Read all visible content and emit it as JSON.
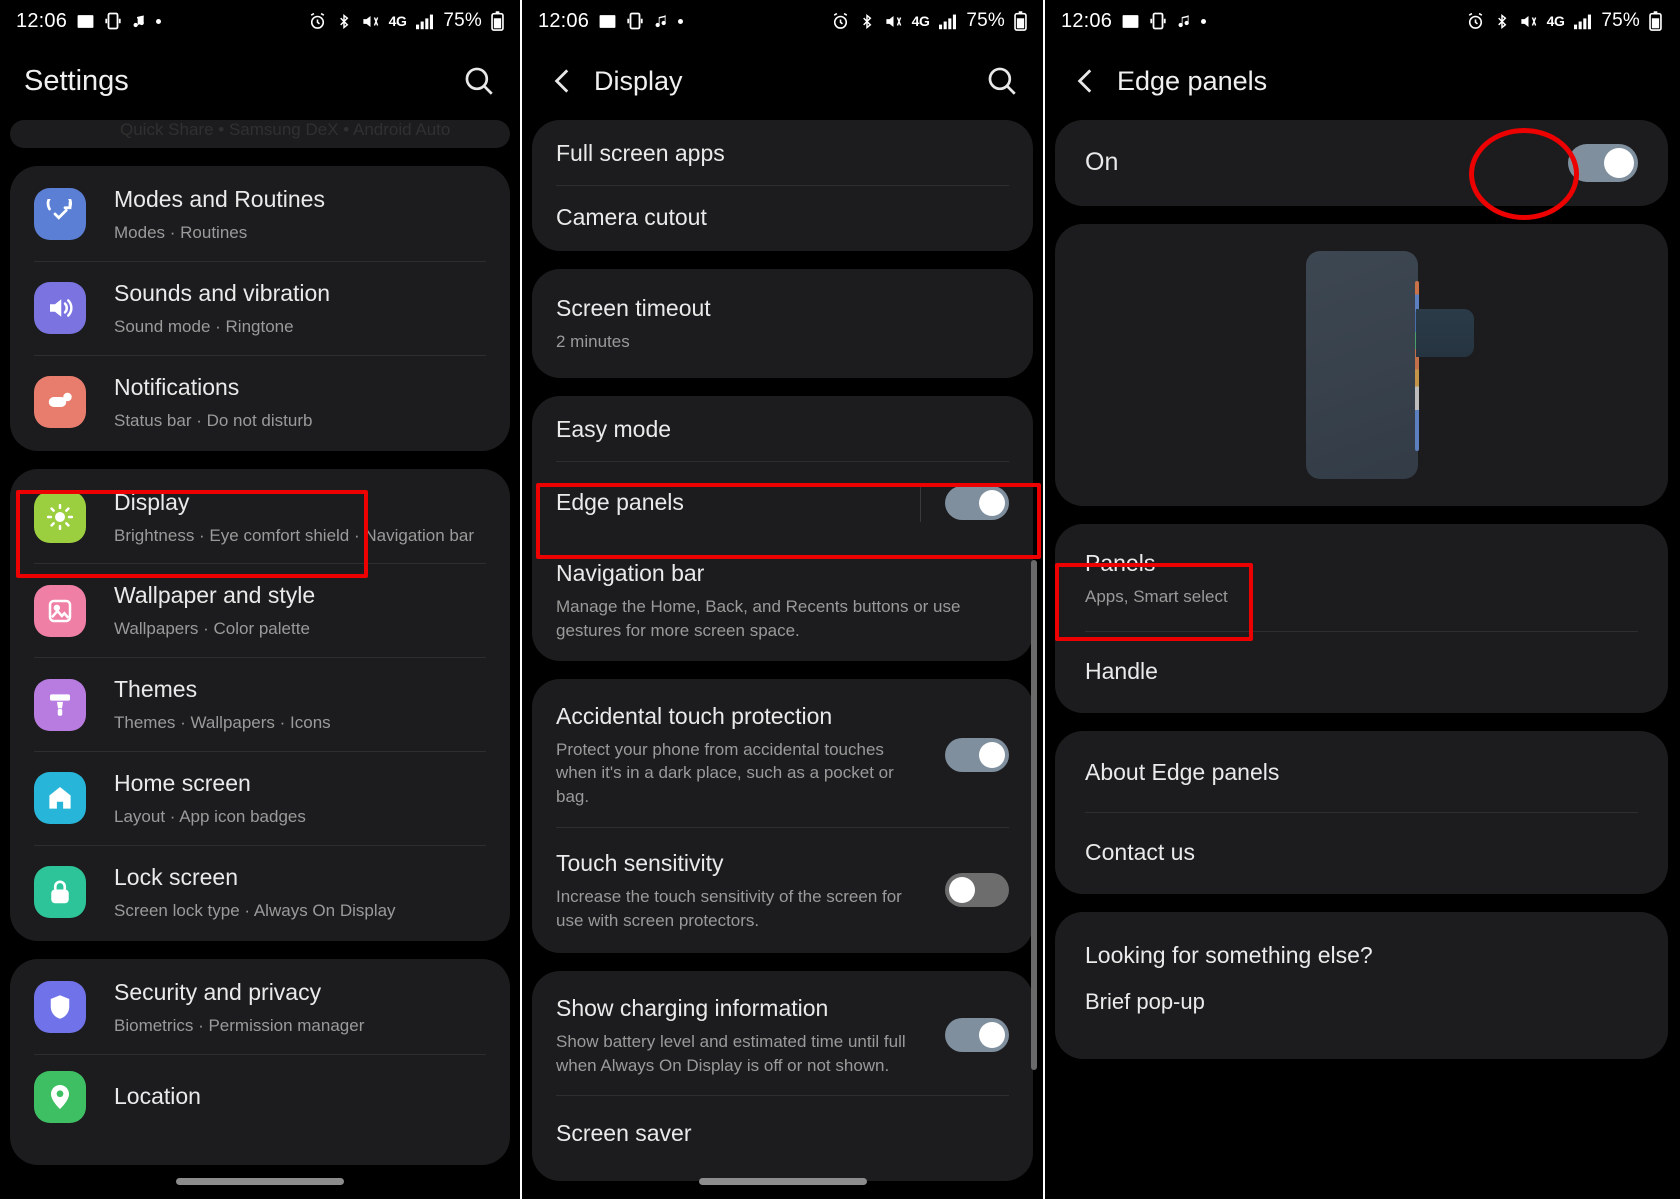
{
  "status_bar": {
    "time": "12:06",
    "left_icons": [
      "photo-icon",
      "screen-record-icon",
      "music-note-icon",
      "dot-icon"
    ],
    "right_icons": [
      "alarm-icon",
      "bluetooth-icon",
      "mute-icon",
      "network-4g-icon",
      "signal-bars-icon"
    ],
    "network_label": "4G",
    "battery_percent": "75%"
  },
  "screen1": {
    "title": "Settings",
    "search_icon": "search-icon",
    "ghost_text": "Quick Share  •  Samsung DeX  •  Android Auto",
    "groups": [
      {
        "items": [
          {
            "label": "Modes and Routines",
            "sub": "Modes  ·  Routines",
            "icon": "modes-routines-icon",
            "color": "#5b7fd4"
          },
          {
            "label": "Sounds and vibration",
            "sub": "Sound mode  ·  Ringtone",
            "icon": "sound-icon",
            "color": "#7b74e0"
          },
          {
            "label": "Notifications",
            "sub": "Status bar  ·  Do not disturb",
            "icon": "notifications-icon",
            "color": "#e87d6e"
          }
        ]
      },
      {
        "items": [
          {
            "label": "Display",
            "sub": "Brightness  ·  Eye comfort shield  ·  Navigation bar",
            "icon": "display-icon",
            "color": "#9ccf3f",
            "highlighted": true
          },
          {
            "label": "Wallpaper and style",
            "sub": "Wallpapers  ·  Color palette",
            "icon": "wallpaper-icon",
            "color": "#ef7fa4"
          },
          {
            "label": "Themes",
            "sub": "Themes  ·  Wallpapers  ·  Icons",
            "icon": "themes-icon",
            "color": "#b87ce0"
          },
          {
            "label": "Home screen",
            "sub": "Layout  ·  App icon badges",
            "icon": "home-screen-icon",
            "color": "#27b5d9"
          },
          {
            "label": "Lock screen",
            "sub": "Screen lock type  ·  Always On Display",
            "icon": "lock-screen-icon",
            "color": "#2ec49a"
          }
        ]
      },
      {
        "items": [
          {
            "label": "Security and privacy",
            "sub": "Biometrics  ·  Permission manager",
            "icon": "security-icon",
            "color": "#6f72e8"
          },
          {
            "label": "Location",
            "sub": "",
            "icon": "location-icon",
            "color": "#3fbf63"
          }
        ]
      }
    ]
  },
  "screen2": {
    "title": "Display",
    "back_icon": "chevron-left-icon",
    "search_icon": "search-icon",
    "groups": [
      {
        "items": [
          {
            "label": "Full screen apps",
            "sub": ""
          },
          {
            "label": "Camera cutout",
            "sub": ""
          }
        ]
      },
      {
        "items": [
          {
            "label": "Screen timeout",
            "sub": "2 minutes"
          }
        ]
      },
      {
        "items": [
          {
            "label": "Easy mode",
            "sub": ""
          },
          {
            "label": "Edge panels",
            "sub": "",
            "toggle": "on",
            "highlighted": true
          },
          {
            "label": "Navigation bar",
            "sub": "Manage the Home, Back, and Recents buttons or use gestures for more screen space."
          }
        ]
      },
      {
        "items": [
          {
            "label": "Accidental touch protection",
            "sub": "Protect your phone from accidental touches when it's in a dark place, such as a pocket or bag.",
            "toggle": "on"
          },
          {
            "label": "Touch sensitivity",
            "sub": "Increase the touch sensitivity of the screen for use with screen protectors.",
            "toggle": "off"
          }
        ]
      },
      {
        "items": [
          {
            "label": "Show charging information",
            "sub": "Show battery level and estimated time until full when Always On Display is off or not shown.",
            "toggle": "on"
          },
          {
            "label": "Screen saver",
            "sub": ""
          }
        ]
      }
    ]
  },
  "screen3": {
    "title": "Edge panels",
    "back_icon": "chevron-left-icon",
    "master_toggle": {
      "label": "On",
      "state": "on",
      "highlighted": true
    },
    "preview": {
      "name": "edge-panel-preview"
    },
    "groups": [
      {
        "items": [
          {
            "label": "Panels",
            "sub": "Apps, Smart select",
            "highlighted": true
          },
          {
            "label": "Handle",
            "sub": ""
          }
        ]
      },
      {
        "items": [
          {
            "label": "About Edge panels",
            "sub": ""
          },
          {
            "label": "Contact us",
            "sub": ""
          }
        ]
      }
    ],
    "footer": {
      "heading": "Looking for something else?",
      "link": "Brief pop-up"
    }
  },
  "colors": {
    "annotation_red": "#ec0000",
    "card_bg": "#1c1c1e",
    "page_bg": "#000000",
    "toggle_on": "#7f8f9e",
    "toggle_off": "#6d6d6d"
  }
}
